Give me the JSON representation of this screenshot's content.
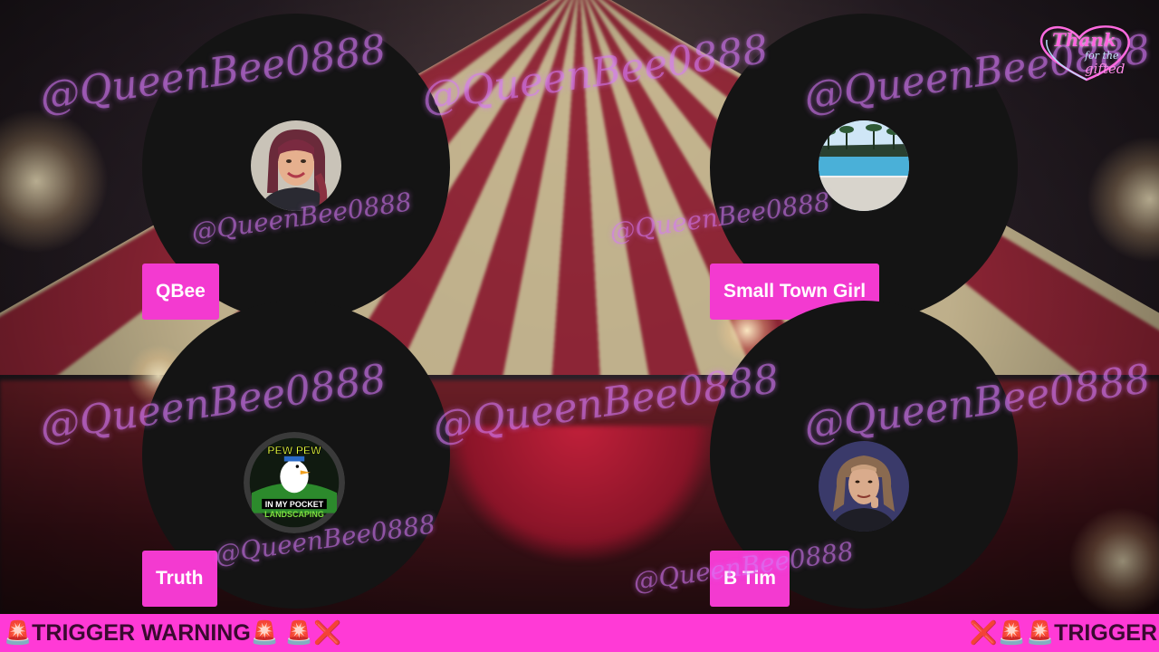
{
  "theme": {
    "accent": "#f33ad0",
    "ticker_bg": "#ff3ad6",
    "disc": "#141414",
    "watermark": "#d678f5"
  },
  "speakers": [
    {
      "name": "QBee",
      "avatar": "woman-portrait-avatar"
    },
    {
      "name": "Small Town Girl",
      "avatar": "pool-scene-avatar"
    },
    {
      "name": "Truth",
      "avatar": "duck-landscaping-logo-avatar",
      "avatar_text": [
        "PEW PEW",
        "IN MY POCKET",
        "LANDSCAPING"
      ]
    },
    {
      "name": "B Tim",
      "avatar": "man-portrait-avatar"
    }
  ],
  "watermark": {
    "text": "@QueenBee0888"
  },
  "logo": {
    "title": "Thank",
    "sub_line1": "for the",
    "sub_line2": "gifted"
  },
  "ticker": {
    "left_text": "🚨TRIGGER WARNING🚨 🚨❌",
    "right_text": "❌🚨🚨TRIGGER"
  }
}
